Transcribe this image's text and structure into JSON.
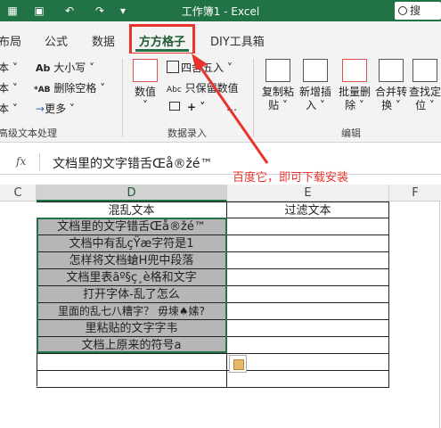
{
  "titlebar": {
    "title": "工作簿1  -  Excel",
    "search_label": "搜"
  },
  "tabs": [
    {
      "label": "布局",
      "active": false
    },
    {
      "label": "公式",
      "active": false
    },
    {
      "label": "数据",
      "active": false
    },
    {
      "label": "方方格子",
      "active": true
    },
    {
      "label": "DIY工具箱",
      "active": false
    }
  ],
  "ribbon": {
    "left_items": [
      "本 ˅",
      "本 ˅",
      "本 ˅"
    ],
    "text_group": {
      "size_label": "大小写 ˅",
      "delete_space_label": "删除空格 ˅",
      "more_label": "更多 ˅",
      "group_label": "高级文本处理"
    },
    "data_group": {
      "numeric_label": "数值",
      "rounding_label": "四舍五入 ˅",
      "keep_value_label": "只保留数值",
      "plus_label": "+ ˅",
      "group_label": "数据录入"
    },
    "edit_group": {
      "buttons": [
        {
          "label_1": "复制粘",
          "label_2": "贴 ˅"
        },
        {
          "label_1": "新增插",
          "label_2": "入 ˅"
        },
        {
          "label_1": "批量删",
          "label_2": "除 ˅"
        },
        {
          "label_1": "合并转",
          "label_2": "换 ˅"
        },
        {
          "label_1": "查找定",
          "label_2": "位 ˅"
        }
      ],
      "group_label": "编辑"
    }
  },
  "formula_bar": {
    "fx": "fx",
    "content": "文档里的文字错舌Œå®žé™"
  },
  "annotation": "百度它，即可下载安装",
  "columns": [
    "C",
    "D",
    "E",
    "F"
  ],
  "sheet": {
    "header_d": "混乱文本",
    "header_e": "过滤文本",
    "rows": [
      "文档里的文字错舌Œå®žé™",
      "文档中有乱çŸæ字符是1",
      "怎样将文档螥H兜中段落",
      "文档里表ãº§ç¸è格和文字",
      "打开字体-乱了怎么",
      "里面的乱七八糟字？   毋堜♠嫊?",
      "里粘贴的文字字韦",
      "文档上原来的符号a"
    ]
  },
  "colors": {
    "excel_green": "#217346",
    "highlight_red": "#e8342c",
    "selection_gray": "#b6b6b6"
  }
}
